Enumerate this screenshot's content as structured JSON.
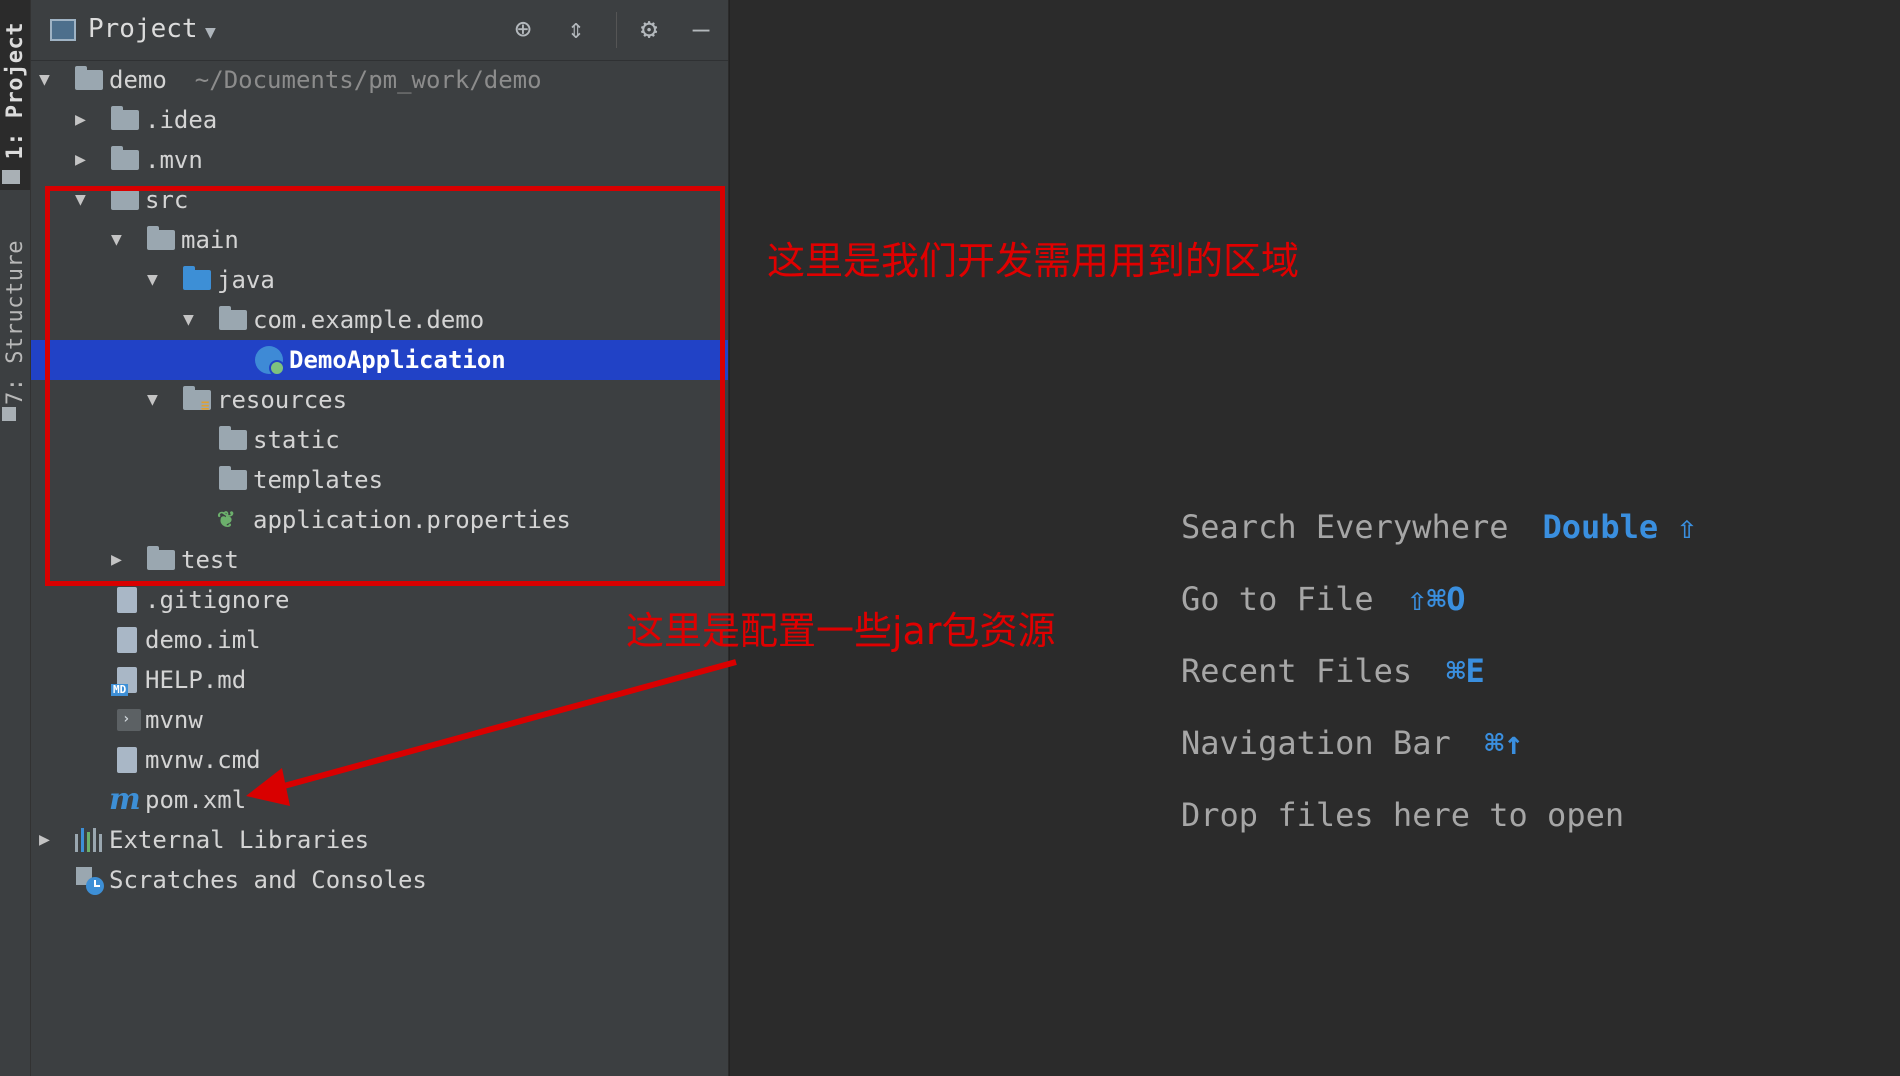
{
  "tool_strip": {
    "project_tab": "1: Project",
    "structure_tab": "7: Structure"
  },
  "panel": {
    "title": "Project"
  },
  "tree": {
    "root": {
      "name": "demo",
      "path": "~/Documents/pm_work/demo"
    },
    "items": [
      {
        "label": ".idea"
      },
      {
        "label": ".mvn"
      },
      {
        "label": "src"
      },
      {
        "label": "main"
      },
      {
        "label": "java"
      },
      {
        "label": "com.example.demo"
      },
      {
        "label": "DemoApplication"
      },
      {
        "label": "resources"
      },
      {
        "label": "static"
      },
      {
        "label": "templates"
      },
      {
        "label": "application.properties"
      },
      {
        "label": "test"
      },
      {
        "label": ".gitignore"
      },
      {
        "label": "demo.iml"
      },
      {
        "label": "HELP.md"
      },
      {
        "label": "mvnw"
      },
      {
        "label": "mvnw.cmd"
      },
      {
        "label": "pom.xml"
      },
      {
        "label": "External Libraries"
      },
      {
        "label": "Scratches and Consoles"
      }
    ]
  },
  "editor": {
    "hints": [
      {
        "action": "Search Everywhere",
        "shortcut": "Double ⇧"
      },
      {
        "action": "Go to File",
        "shortcut": "⇧⌘O"
      },
      {
        "action": "Recent Files",
        "shortcut": "⌘E"
      },
      {
        "action": "Navigation Bar",
        "shortcut": "⌘↑"
      },
      {
        "action": "Drop files here to open",
        "shortcut": ""
      }
    ]
  },
  "annotations": {
    "src_note": "这里是我们开发需用用到的区域",
    "jar_note": "这里是配置一些jar包资源"
  },
  "colors": {
    "panel_bg": "#3c3f41",
    "editor_bg": "#2b2b2b",
    "selection": "#2142c6",
    "shortcut": "#3a8fdf",
    "annotation": "#e00000"
  }
}
